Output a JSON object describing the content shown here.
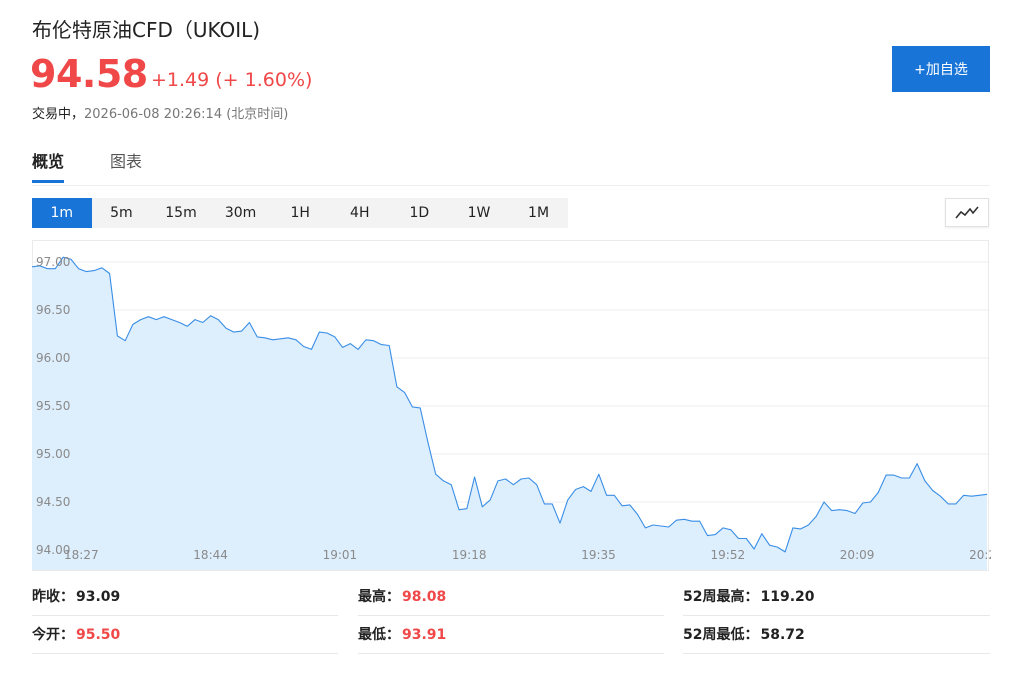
{
  "quote": {
    "title": "布伦特原油CFD（UKOIL)",
    "price": "94.58",
    "change": "+1.49 (+ 1.60%)",
    "status_label": "交易中，",
    "timestamp": "2026-06-08 20:26:14",
    "timezone": "(北京时间)"
  },
  "actions": {
    "add_watchlist": "+加自选"
  },
  "tabs": [
    {
      "label": "概览"
    },
    {
      "label": "图表"
    }
  ],
  "ranges": [
    {
      "label": "1m"
    },
    {
      "label": "5m"
    },
    {
      "label": "15m"
    },
    {
      "label": "30m"
    },
    {
      "label": "1H"
    },
    {
      "label": "4H"
    },
    {
      "label": "1D"
    },
    {
      "label": "1W"
    },
    {
      "label": "1M"
    }
  ],
  "active_range": "1m",
  "chart_type_icon": "line-chart-icon",
  "colors": {
    "up": "#f04848",
    "accent": "#1874d6",
    "line": "#3a8ee6",
    "area": "#ddeefd"
  },
  "chart_data": {
    "type": "area",
    "ylim": [
      94.0,
      97.0
    ],
    "y_ticks": [
      "97.00",
      "96.50",
      "96.00",
      "95.50",
      "95.00",
      "94.50",
      "94.00"
    ],
    "x_ticks": [
      "18:27",
      "18:44",
      "19:01",
      "19:18",
      "19:35",
      "19:52",
      "20:09",
      "20:2"
    ],
    "values": [
      96.95,
      96.96,
      96.93,
      96.93,
      97.05,
      97.03,
      96.93,
      96.9,
      96.91,
      96.94,
      96.88,
      96.23,
      96.18,
      96.35,
      96.4,
      96.43,
      96.4,
      96.43,
      96.4,
      96.37,
      96.33,
      96.4,
      96.37,
      96.44,
      96.4,
      96.31,
      96.27,
      96.28,
      96.37,
      96.22,
      96.21,
      96.19,
      96.2,
      96.21,
      96.19,
      96.12,
      96.09,
      96.27,
      96.26,
      96.22,
      96.11,
      96.15,
      96.09,
      96.19,
      96.18,
      96.14,
      96.13,
      95.7,
      95.64,
      95.49,
      95.48,
      95.12,
      94.79,
      94.72,
      94.68,
      94.42,
      94.43,
      94.76,
      94.45,
      94.52,
      94.72,
      94.74,
      94.68,
      94.74,
      94.75,
      94.68,
      94.48,
      94.48,
      94.28,
      94.52,
      94.63,
      94.66,
      94.61,
      94.79,
      94.57,
      94.57,
      94.46,
      94.47,
      94.37,
      94.23,
      94.26,
      94.25,
      94.24,
      94.31,
      94.32,
      94.3,
      94.3,
      94.15,
      94.16,
      94.23,
      94.21,
      94.12,
      94.12,
      94.01,
      94.17,
      94.05,
      94.03,
      93.98,
      94.23,
      94.22,
      94.26,
      94.35,
      94.5,
      94.41,
      94.42,
      94.41,
      94.38,
      94.49,
      94.5,
      94.6,
      94.78,
      94.78,
      94.75,
      94.75,
      94.9,
      94.72,
      94.62,
      94.56,
      94.48,
      94.48,
      94.57,
      94.56,
      94.57,
      94.58
    ]
  },
  "stats": [
    {
      "label": "昨收：",
      "value": "93.09",
      "highlight": false
    },
    {
      "label": "最高：",
      "value": "98.08",
      "highlight": true
    },
    {
      "label": "52周最高：",
      "value": "119.20",
      "highlight": false
    },
    {
      "label": "今开：",
      "value": "95.50",
      "highlight": true
    },
    {
      "label": "最低：",
      "value": "93.91",
      "highlight": true
    },
    {
      "label": "52周最低：",
      "value": "58.72",
      "highlight": false
    }
  ]
}
